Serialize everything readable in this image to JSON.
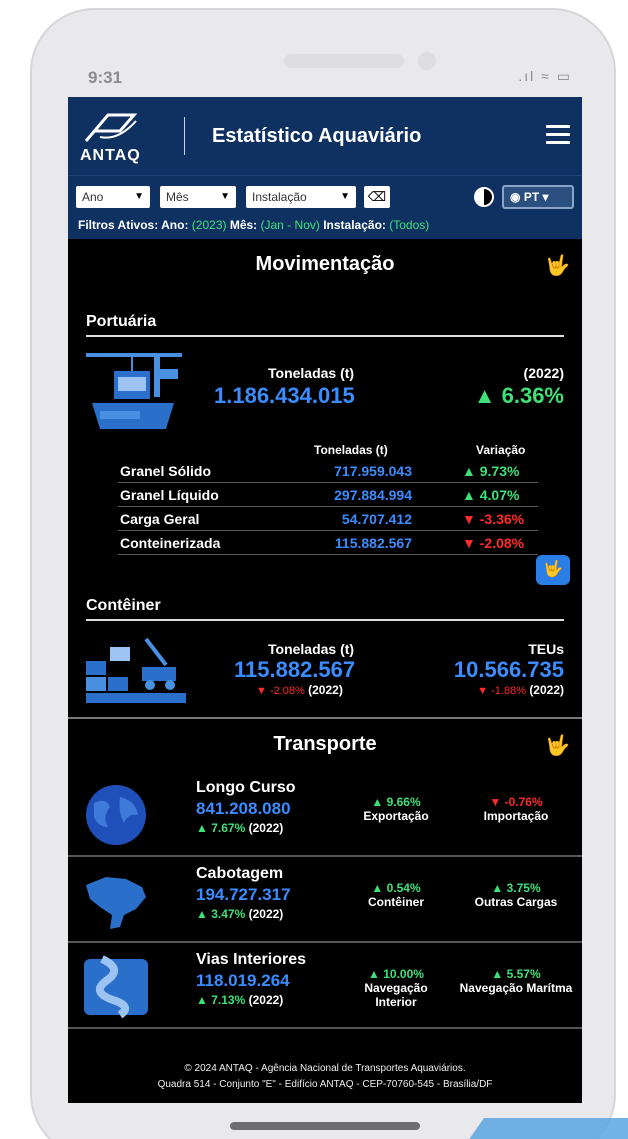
{
  "status_bar": {
    "time": "9:31",
    "icons": ".ıl ≈ ▭"
  },
  "header": {
    "logo_text": "ANTAQ",
    "title": "Estatístico Aquaviário"
  },
  "filters": {
    "ano": "Ano",
    "mes": "Mês",
    "instalacao": "Instalação",
    "lang": "PT",
    "active_label": "Filtros Ativos:",
    "ano_label": "Ano:",
    "ano_value": "(2023)",
    "mes_label": "Mês:",
    "mes_value": "(Jan - Nov)",
    "inst_label": "Instalação:",
    "inst_value": "(Todos)"
  },
  "movimentacao": {
    "title": "Movimentação",
    "portuaria": {
      "title": "Portuária",
      "label": "Toneladas (t)",
      "total": "1.186.434.015",
      "year": "(2022)",
      "variation": "▲ 6.36%",
      "table": {
        "col_tons": "Toneladas (t)",
        "col_var": "Variação",
        "rows": [
          {
            "name": "Granel Sólido",
            "value": "717.959.043",
            "var": "▲ 9.73%",
            "dir": "up"
          },
          {
            "name": "Granel Líquido",
            "value": "297.884.994",
            "var": "▲ 4.07%",
            "dir": "up"
          },
          {
            "name": "Carga Geral",
            "value": "54.707.412",
            "var": "▼ -3.36%",
            "dir": "down"
          },
          {
            "name": "Conteinerizada",
            "value": "115.882.567",
            "var": "▼ -2.08%",
            "dir": "down"
          }
        ]
      }
    },
    "conteiner": {
      "title": "Contêiner",
      "tons_label": "Toneladas (t)",
      "tons_value": "115.882.567",
      "tons_var": "▼ -2.08%",
      "tons_year": "(2022)",
      "teu_label": "TEUs",
      "teu_value": "10.566.735",
      "teu_var": "▼ -1.88%",
      "teu_year": "(2022)"
    }
  },
  "transporte": {
    "title": "Transporte",
    "rows": [
      {
        "name": "Longo Curso",
        "value": "841.208.080",
        "var": "▲ 7.67%",
        "year": "(2022)",
        "m1_var": "▲ 9.66%",
        "m1_dir": "up",
        "m1_label": "Exportação",
        "m2_var": "▼ -0.76%",
        "m2_dir": "down",
        "m2_label": "Importação"
      },
      {
        "name": "Cabotagem",
        "value": "194.727.317",
        "var": "▲ 3.47%",
        "year": "(2022)",
        "m1_var": "▲ 0.54%",
        "m1_dir": "up",
        "m1_label": "Contêiner",
        "m2_var": "▲ 3.75%",
        "m2_dir": "up",
        "m2_label": "Outras Cargas"
      },
      {
        "name": "Vias Interiores",
        "value": "118.019.264",
        "var": "▲ 7.13%",
        "year": "(2022)",
        "m1_var": "▲ 10.00%",
        "m1_dir": "up",
        "m1_label": "Navegação Interior",
        "m2_var": "▲ 5.57%",
        "m2_dir": "up",
        "m2_label": "Navegação Marítma"
      }
    ]
  },
  "footer": {
    "line1": "© 2024 ANTAQ - Agência Nacional de Transportes Aquaviários.",
    "line2": "Quadra 514 - Conjunto \"E\" - Edifício ANTAQ - CEP-70760-545 - Brasília/DF"
  },
  "colors": {
    "navy": "#0f3161",
    "accent_blue": "#3b8cff",
    "up_green": "#3fe07a",
    "down_red": "#ff2a2a"
  },
  "icons": [
    "contrast-icon",
    "globe-icon",
    "menu-icon",
    "eraser-icon",
    "sign-language-icon"
  ]
}
